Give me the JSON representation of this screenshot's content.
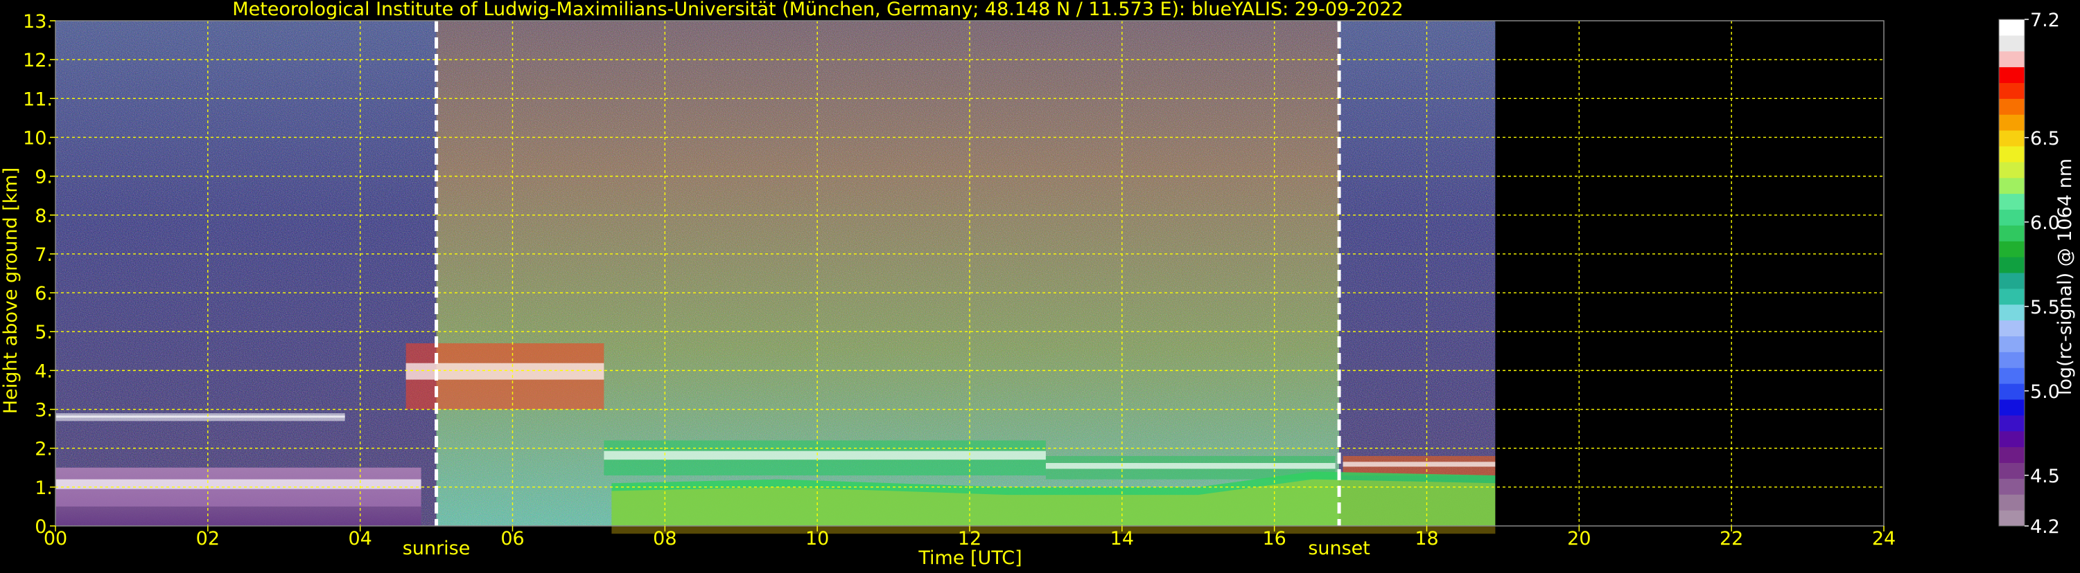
{
  "chart_data": {
    "type": "heatmap",
    "title": "Meteorological Institute of Ludwig-Maximilians-Universität (München, Germany; 48.148 N / 11.573 E):     blueYALIS: 29-09-2022",
    "xlabel": "Time [UTC]",
    "ylabel": "Height above ground [km]",
    "xlim": [
      0,
      24
    ],
    "ylim": [
      0,
      13
    ],
    "x_ticks": [
      0,
      2,
      4,
      6,
      8,
      10,
      12,
      14,
      16,
      18,
      20,
      22,
      24
    ],
    "x_tick_labels": [
      "00",
      "02",
      "04",
      "06",
      "08",
      "10",
      "12",
      "14",
      "16",
      "18",
      "20",
      "22",
      "24"
    ],
    "y_ticks": [
      0,
      1,
      2,
      3,
      4,
      5,
      6,
      7,
      8,
      9,
      10,
      11,
      12,
      13
    ],
    "y_tick_labels": [
      "0.",
      "1.",
      "2.",
      "3.",
      "4.",
      "5.",
      "6.",
      "7.",
      "8.",
      "9.",
      "10.",
      "11.",
      "12.",
      "13."
    ],
    "grid": true,
    "data_end_time": 18.9,
    "annotations": [
      {
        "label": "sunrise",
        "time": 5.0
      },
      {
        "label": "sunset",
        "time": 16.85
      }
    ],
    "colorbar": {
      "label": "log(rc-signal) @ 1064 nm",
      "range": [
        4.2,
        7.2
      ],
      "tick_values": [
        4.2,
        4.5,
        5.0,
        5.5,
        6.0,
        6.5,
        7.2
      ],
      "tick_labels": [
        "4.2",
        "4.5",
        "5.0",
        "5.5",
        "6.0",
        "6.5",
        "7.2"
      ],
      "colors": [
        "#a890a8",
        "#9a7a9c",
        "#8a5a94",
        "#7a3a88",
        "#6e1c86",
        "#5a0aa0",
        "#3a10c8",
        "#1010e0",
        "#2a4af0",
        "#4a70f8",
        "#6a8cf8",
        "#8aa8f8",
        "#a8c0f8",
        "#7ad8e0",
        "#30c0a8",
        "#20a890",
        "#10a040",
        "#20b030",
        "#30c860",
        "#40d888",
        "#60e8a0",
        "#a0f060",
        "#d0f040",
        "#f0f020",
        "#f8d010",
        "#f8a000",
        "#f87000",
        "#f83000",
        "#f80000",
        "#f8c0c0",
        "#e8e8e8",
        "#ffffff"
      ]
    },
    "cloud_layers": [
      {
        "t0": 0.0,
        "t1": 3.8,
        "base": 2.7,
        "top": 2.9
      },
      {
        "t0": 0.0,
        "t1": 4.8,
        "base": 0.5,
        "top": 1.5
      },
      {
        "t0": 4.6,
        "t1": 7.2,
        "base": 3.0,
        "top": 4.7
      },
      {
        "t0": 7.2,
        "t1": 13.0,
        "base": 1.3,
        "top": 2.2
      },
      {
        "t0": 13.0,
        "t1": 16.8,
        "base": 1.2,
        "top": 1.8
      },
      {
        "t0": 16.9,
        "t1": 18.9,
        "base": 1.3,
        "top": 1.8
      }
    ],
    "boundary_layer": [
      [
        7.3,
        1.1
      ],
      [
        9.5,
        1.2
      ],
      [
        12.5,
        1.0
      ],
      [
        15.0,
        1.0
      ],
      [
        16.5,
        1.4
      ],
      [
        18.9,
        1.3
      ]
    ]
  },
  "colors": {
    "background": "#000000",
    "text": "#ffff00",
    "grid": "#ffff00",
    "colorbar_text": "#ffffff",
    "marker_line": "#ffffff"
  }
}
